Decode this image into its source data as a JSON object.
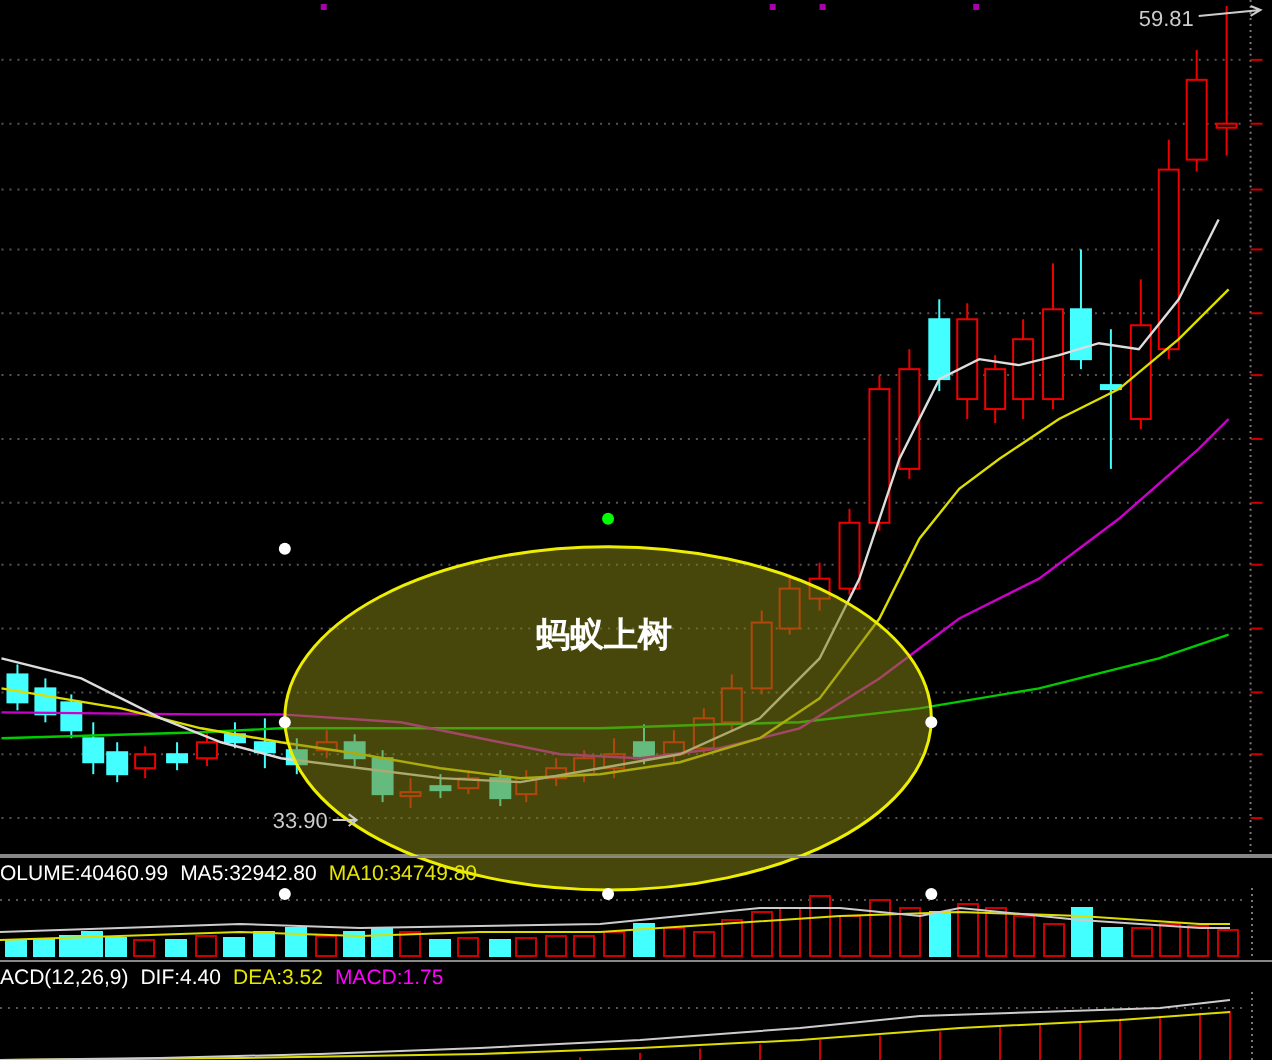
{
  "main_chart": {
    "annotation": {
      "label": "蚂蚁上树"
    },
    "high_label": "59.81",
    "low_label": "33.90"
  },
  "volume_panel": {
    "indicators": [
      {
        "text": "OLUME:40460.99",
        "color": "#ffffff"
      },
      {
        "text": "MA5:32942.80",
        "color": "#ffffff"
      },
      {
        "text": "MA10:34749.80",
        "color": "#e6e600"
      }
    ]
  },
  "macd_panel": {
    "indicators": [
      {
        "text": "ACD(12,26,9)",
        "color": "#ffffff"
      },
      {
        "text": "DIF:4.40",
        "color": "#ffffff"
      },
      {
        "text": "DEA:3.52",
        "color": "#e6e600"
      },
      {
        "text": "MACD:1.75",
        "color": "#ff00ff"
      }
    ]
  }
}
